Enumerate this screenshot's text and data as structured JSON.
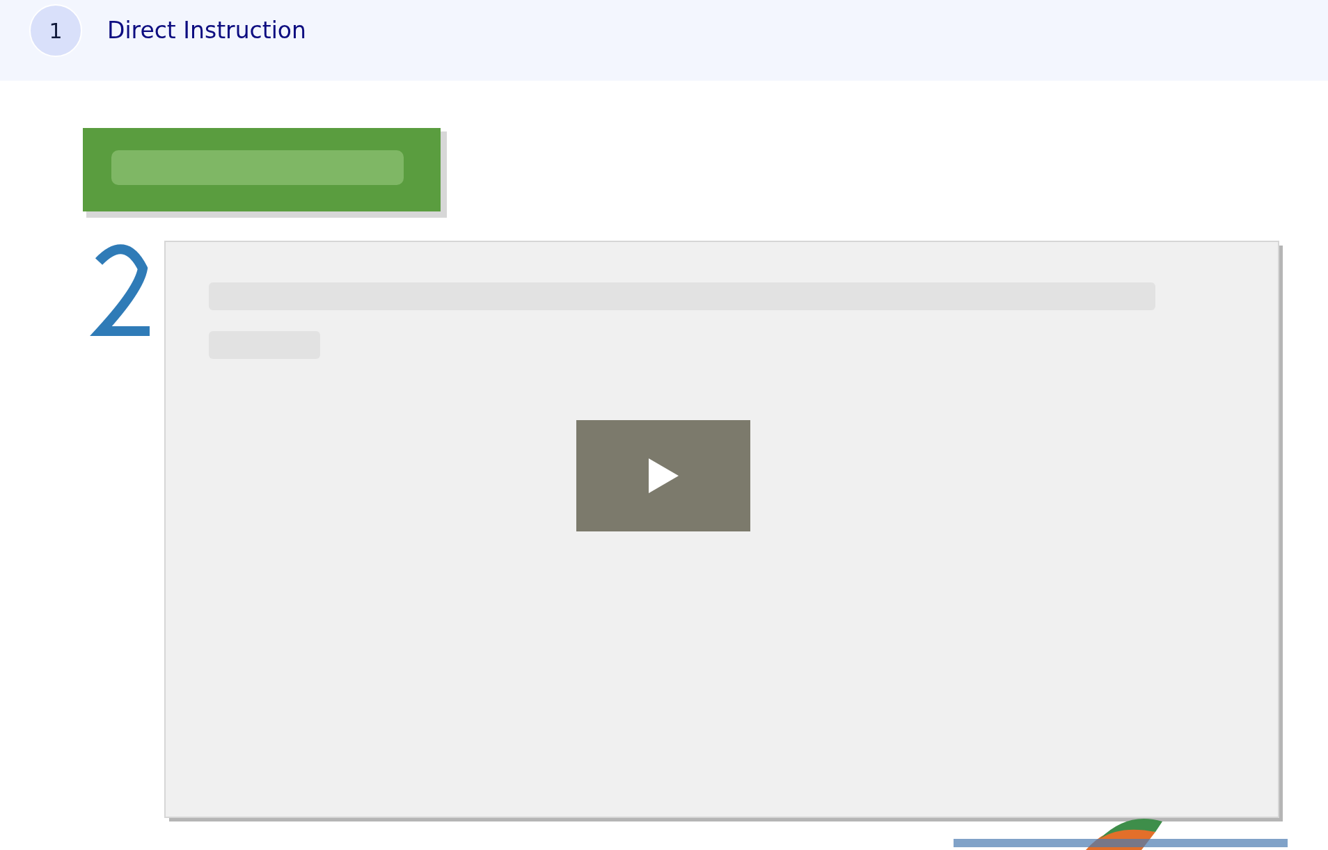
{
  "section": {
    "number": "1",
    "title": "Direct Instruction"
  }
}
